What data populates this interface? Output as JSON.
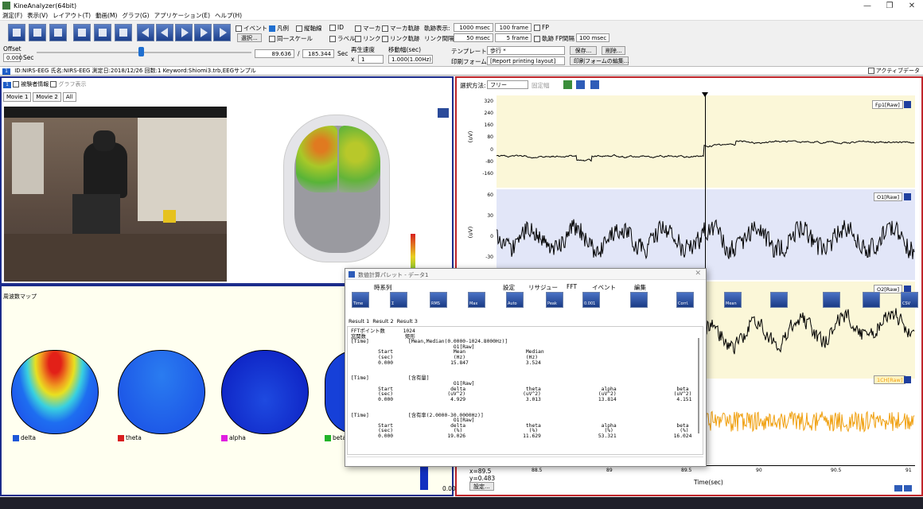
{
  "window": {
    "title": "KineAnalyzer(64bit)",
    "min": "—",
    "max": "❐",
    "close": "✕"
  },
  "menu": [
    "測定(F)",
    "表示(V)",
    "レイアウト(T)",
    "動画(M)",
    "グラフ(G)",
    "アプリケーション(E)",
    "ヘルプ(H)"
  ],
  "toolbar": {
    "event": "イベント",
    "legend": "凡例",
    "vline": "縦軸線",
    "select": "選択...",
    "same_scale": "同一スケール",
    "id": "ID",
    "marker": "マーカ",
    "marker_trace": "マーカ軌跡",
    "label": "ラベル",
    "link": "リンク",
    "link_trace": "リンク軌跡",
    "trace_display": "軌跡表示:",
    "trace_ms": "1000 msec",
    "trace_frames": "100 frame",
    "link_interval": "リンク間隔",
    "link_ms": "50 msec",
    "link_frames": "5 frame",
    "fp": "FP",
    "trace": "軌跡",
    "fp_interval": "FP間隔",
    "fp_ms": "100 msec",
    "offset_label": "Offset",
    "offset_value": "0.000",
    "offset_unit": "Sec",
    "position": "89.636",
    "separator": "/",
    "duration": "185.344",
    "sec": "Sec",
    "speed_label": "再生速度",
    "speed_value": "1",
    "speed_prefix": "x",
    "move_label": "移動幅(sec)",
    "move_value": "1.000(1.00Hz)",
    "template_label": "テンプレート:",
    "template_value": "歩行 *",
    "save": "保存...",
    "delete": "削除...",
    "print_label": "印刷フォーム:",
    "print_value": "[Report printing layout]",
    "print_edit": "印刷フォームの編集...",
    "active_data": "アクティブデータ"
  },
  "infobar": {
    "num": "1",
    "text": "ID:NIRS-EEG 氏名:NIRS-EEG 測定日:2018/12/26 回数:1 Keyword:Shiomi3.trb,EEGサンプル"
  },
  "video_panel": {
    "num": "1",
    "subject_info": "被験者情報",
    "graph_display": "グラフ表示",
    "tabs": [
      "Movie 1",
      "Movie 2",
      "All"
    ]
  },
  "freq_map": {
    "title": "周波数マップ",
    "bands": [
      "delta",
      "theta",
      "alpha",
      "beta"
    ],
    "band_colors": [
      "#1e57d8",
      "#d81e1e",
      "#e01ee0",
      "#22b42a"
    ],
    "scale_value": "0.00"
  },
  "wave": {
    "method_label": "選択方法:",
    "method_value": "フリー",
    "fixed": "固定幅",
    "channels": [
      {
        "name": "Fp1[Raw]",
        "ylabel": "(uV)",
        "ticks": [
          "320",
          "240",
          "160",
          "80",
          "0",
          "-80",
          "-160"
        ],
        "bg": "#fbf7d8",
        "color": "#000000"
      },
      {
        "name": "O1[Raw]",
        "ylabel": "(uV)",
        "ticks": [
          "60",
          "30",
          "0",
          "-30"
        ],
        "bg": "#e2e6f8",
        "color": "#000000"
      },
      {
        "name": "O2[Raw]",
        "ylabel": "",
        "ticks": [],
        "bg": "#fbf7d8",
        "color": "#000000"
      },
      {
        "name": "1CH[Raw]",
        "ylabel": "",
        "ticks": [],
        "bg": "#ffffff",
        "color": "#f0a010"
      }
    ],
    "xticks": [
      "88.5",
      "89",
      "89.5",
      "90",
      "90.5",
      "91"
    ],
    "xlabel": "Time(sec)",
    "cursor_x": "x=89.5",
    "cursor_y": "y=0.483",
    "settings": "設定..."
  },
  "dialog": {
    "title": "数値計算パレット - データ1",
    "groups": [
      "時系列",
      "設定",
      "リサジュー",
      "FFT",
      "イベント",
      "編集"
    ],
    "icons": [
      "time-icon",
      "sum-icon",
      "rms-icon",
      "maxmin-icon",
      "auto-icon",
      "peak-icon",
      "threshold-icon",
      "settings-icon",
      "correlation-icon",
      "fft-icon",
      "event-icon",
      "eraser-icon",
      "copy-icon",
      "save-csv-icon",
      "xls-icon"
    ],
    "icon_labels": [
      "Time",
      "Σ",
      "RMS",
      "Max",
      "Auto",
      "Peak",
      "0.001",
      "",
      "Corrl.",
      "Mean",
      "",
      "",
      "",
      "CSV",
      "XLS"
    ],
    "tabs": [
      "Result 1",
      "Result 2",
      "Result 3"
    ],
    "result": "FFTポイント数      1024\n窓関数             矩形\n[Time]             [Mean,Median(0.0000-1024.8000Hz)]\n                                  O1[Raw]\n         Start                    Mean                    Median\n         (sec)                    (Hz)                    (Hz)\n         0.000                   15.847                   3.524\n\n\n[Time]             [含有量]\n                                  O1[Raw]\n         Start                   delta                    theta                    alpha                    beta\n         (sec)                  (uV^2)                   (uV^2)                   (uV^2)                   (uV^2)\n         0.000                   4.929                    3.013                   13.814                    4.151\n\n\n[Time]             [含有率(2.0000-30.0000Hz)]\n                                  O1[Raw]\n         Start                   delta                    theta                    alpha                    beta\n         (sec)                    (%)                      (%)                      (%)                      (%)\n         0.000                  19.026                   11.629                   53.321                   16.024"
  }
}
